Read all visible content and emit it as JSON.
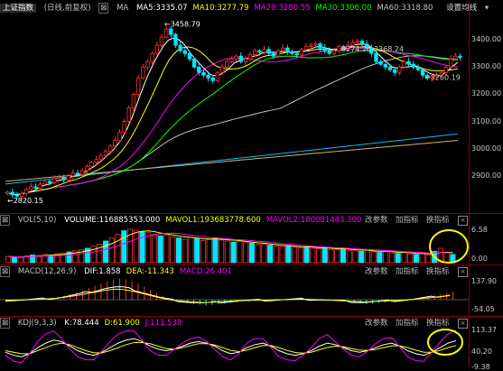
{
  "main": {
    "title": "上证指数",
    "subtitle": "(日线,前复权)",
    "ma_label": "MA",
    "ma_items": [
      {
        "label": "MA5:3335.07",
        "color": "#ffffff"
      },
      {
        "label": "MA10:3277.79",
        "color": "#ffff00"
      },
      {
        "label": "MA20:3280.55",
        "color": "#ff00ff"
      },
      {
        "label": "MA30:3306.00",
        "color": "#00ff00"
      },
      {
        "label": "MA60:3318.80",
        "color": "#c0c0c0"
      }
    ],
    "settings_label": "设置均线",
    "annotations": {
      "high": "3458.79",
      "low": "2820.15",
      "range": "3274.26-3368.24",
      "last_low": "3260.19"
    }
  },
  "vol": {
    "label": "VOL(5,10)",
    "items": [
      {
        "label": "VOLUME:116885353.000",
        "color": "#ffffff"
      },
      {
        "label": "MAVOL1:193683778.600",
        "color": "#ffff00"
      },
      {
        "label": "MAVOL2:180081443.300",
        "color": "#ff00ff"
      }
    ]
  },
  "macd": {
    "label": "MACD(12,26,9)",
    "items": [
      {
        "label": "DIF:1.858",
        "color": "#ffffff"
      },
      {
        "label": "DEA:-11.343",
        "color": "#ffff00"
      },
      {
        "label": "MACD:26.401",
        "color": "#ff00ff"
      }
    ]
  },
  "kdj": {
    "label": "KDJ(9,3,3)",
    "items": [
      {
        "label": "K:78.444",
        "color": "#ffffff"
      },
      {
        "label": "D:61.900",
        "color": "#ffff00"
      },
      {
        "label": "J:111.538",
        "color": "#ff00ff"
      }
    ]
  },
  "buttons": {
    "params": "改参数",
    "add": "加指标",
    "switch": "换指标",
    "close": "×"
  },
  "chart_data": [
    {
      "type": "candlestick",
      "title": "上证指数",
      "ylim": [
        2820,
        3470
      ],
      "y_ticks": [
        "3400.00",
        "3300.00",
        "3200.00",
        "3100.00",
        "3000.00",
        "2900.00"
      ],
      "close": [
        2840,
        2830,
        2825,
        2835,
        2850,
        2860,
        2855,
        2870,
        2880,
        2875,
        2890,
        2895,
        2885,
        2900,
        2910,
        2905,
        2920,
        2935,
        2950,
        2960,
        2975,
        2990,
        3010,
        3030,
        3060,
        3100,
        3150,
        3200,
        3260,
        3300,
        3320,
        3350,
        3380,
        3410,
        3440,
        3420,
        3380,
        3360,
        3350,
        3330,
        3300,
        3280,
        3270,
        3260,
        3250,
        3280,
        3300,
        3320,
        3330,
        3340,
        3320,
        3330,
        3345,
        3360,
        3355,
        3365,
        3350,
        3340,
        3360,
        3370,
        3355,
        3350,
        3345,
        3365,
        3375,
        3380,
        3385,
        3370,
        3360,
        3350,
        3360,
        3375,
        3370,
        3380,
        3390,
        3395,
        3385,
        3370,
        3350,
        3320,
        3310,
        3300,
        3290,
        3280,
        3300,
        3320,
        3310,
        3300,
        3290,
        3270,
        3260,
        3265,
        3270,
        3280,
        3300,
        3330,
        3340,
        3335
      ],
      "high_value": 3458.79,
      "low_value": 2820.15
    },
    {
      "type": "bar",
      "title": "VOL(5,10)",
      "y_ticks": [
        "6.58",
        "0.00"
      ],
      "values": [
        1.2,
        1.1,
        1.0,
        1.3,
        1.5,
        1.4,
        1.6,
        1.5,
        1.7,
        1.9,
        2.1,
        2.3,
        2.5,
        2.8,
        3.2,
        3.6,
        4.2,
        4.8,
        5.5,
        6.2,
        6.5,
        6.3,
        6.0,
        5.8,
        5.5,
        5.2,
        5.4,
        5.0,
        4.8,
        4.5,
        4.9,
        4.7,
        4.3,
        4.5,
        4.8,
        4.4,
        4.2,
        4.0,
        4.1,
        3.9,
        3.8,
        3.5,
        3.6,
        3.4,
        3.2,
        3.1,
        3.3,
        3.0,
        2.9,
        3.1,
        2.8,
        2.7,
        2.9,
        2.6,
        2.5,
        2.8,
        2.4,
        2.3,
        2.2,
        2.5,
        2.1,
        2.0,
        2.3,
        1.9,
        1.8,
        2.0,
        1.7,
        1.6,
        1.8,
        1.5,
        2.2,
        2.8,
        1.9,
        1.6
      ]
    },
    {
      "type": "bar",
      "title": "MACD(12,26,9)",
      "y_ticks": [
        "137.90",
        "-54.05"
      ],
      "values": [
        -2,
        -3,
        -2,
        -1,
        0,
        2,
        4,
        6,
        9,
        13,
        18,
        24,
        30,
        38,
        45,
        52,
        60,
        65,
        68,
        66,
        60,
        52,
        42,
        32,
        22,
        12,
        4,
        -2,
        -6,
        -10,
        -14,
        -16,
        -18,
        -17,
        -15,
        -12,
        -10,
        -8,
        -6,
        -5,
        -4,
        -3,
        -2,
        -2,
        -1,
        0,
        1,
        2,
        3,
        2,
        1,
        0,
        -2,
        -4,
        -6,
        -8,
        -10,
        -12,
        -14,
        -13,
        -11,
        -9,
        -7,
        -5,
        -3,
        -1,
        2,
        6,
        10,
        14,
        18,
        22,
        26
      ]
    },
    {
      "type": "line",
      "title": "KDJ(9,3,3)",
      "y_ticks": [
        "113.37",
        "40.20",
        "-9.38"
      ],
      "series": [
        {
          "name": "K",
          "values": [
            40,
            30,
            25,
            35,
            55,
            70,
            80,
            75,
            60,
            45,
            35,
            30,
            40,
            55,
            70,
            80,
            85,
            75,
            60,
            50,
            45,
            50,
            60,
            70,
            75,
            70,
            60,
            45,
            35,
            40,
            55,
            65,
            70,
            60,
            45,
            35,
            30,
            35,
            45,
            60,
            70,
            65,
            55,
            45,
            40,
            45,
            55,
            65,
            70,
            60,
            45,
            35,
            30,
            40,
            55,
            70,
            78
          ]
        },
        {
          "name": "D",
          "values": [
            45,
            40,
            35,
            35,
            45,
            55,
            65,
            70,
            65,
            55,
            45,
            38,
            38,
            45,
            55,
            65,
            72,
            72,
            68,
            60,
            52,
            50,
            55,
            62,
            68,
            68,
            64,
            55,
            46,
            42,
            47,
            55,
            62,
            62,
            55,
            46,
            39,
            37,
            40,
            48,
            56,
            60,
            58,
            52,
            47,
            46,
            49,
            55,
            61,
            61,
            55,
            47,
            40,
            40,
            46,
            55,
            62
          ]
        },
        {
          "name": "J",
          "values": [
            30,
            10,
            5,
            35,
            75,
            100,
            110,
            85,
            50,
            25,
            15,
            15,
            45,
            75,
            100,
            110,
            110,
            80,
            45,
            30,
            30,
            50,
            70,
            85,
            90,
            75,
            50,
            25,
            15,
            35,
            70,
            85,
            85,
            55,
            25,
            15,
            12,
            30,
            55,
            85,
            98,
            75,
            50,
            30,
            25,
            43,
            68,
            85,
            88,
            58,
            25,
            12,
            10,
            40,
            73,
            100,
            112
          ]
        }
      ]
    }
  ]
}
